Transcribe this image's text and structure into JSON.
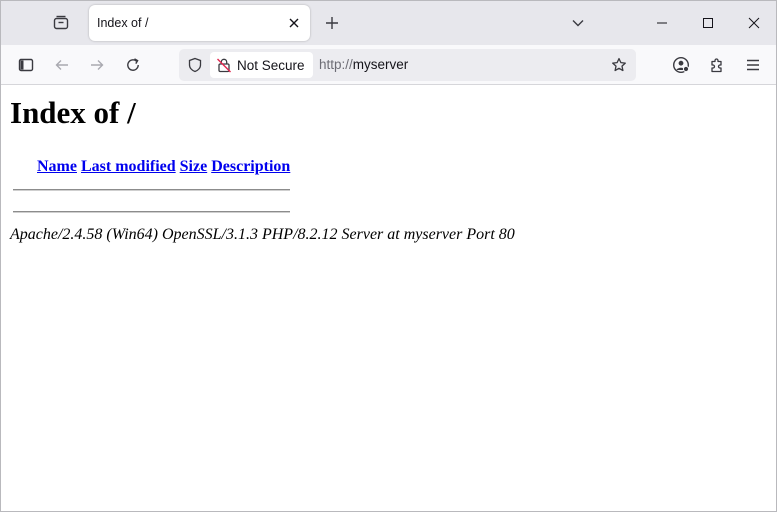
{
  "browser": {
    "tab": {
      "title": "Index of /"
    },
    "security": {
      "label": "Not Secure"
    },
    "url": {
      "scheme": "http://",
      "host": "myserver"
    }
  },
  "page": {
    "heading": "Index of /",
    "columns": [
      "Name",
      "Last modified",
      "Size",
      "Description"
    ],
    "address": "Apache/2.4.58 (Win64) OpenSSL/3.1.3 PHP/8.2.12 Server at myserver Port 80"
  },
  "colors": {
    "link": "#0000ee",
    "tabstrip": "#e7e7ec",
    "toolbar": "#f9f9fb",
    "urlbar": "#ececf0"
  }
}
